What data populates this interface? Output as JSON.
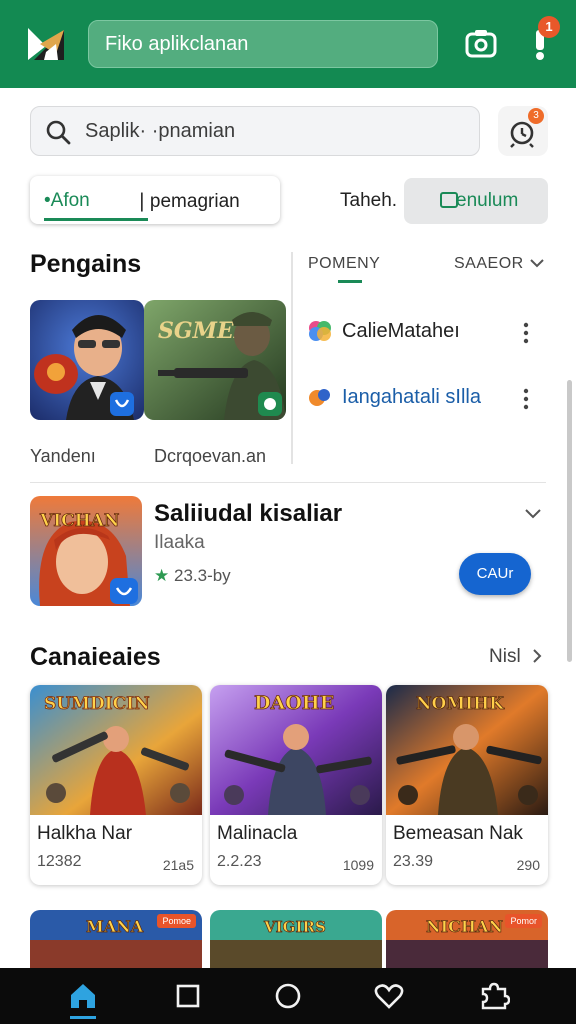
{
  "header": {
    "search_text": "Fiko aplikclanan",
    "notif_badge": "1"
  },
  "search": {
    "placeholder": "Saplik· ·pnamian",
    "notif_badge": "3"
  },
  "filters": {
    "chip1_part1": "•Afon",
    "chip1_part2": "❘pemagrian",
    "tab_label": "Taheh.",
    "chip2_label": "enulum"
  },
  "section1": {
    "title": "Pengains",
    "cards": [
      {
        "caption": "Yandenı",
        "art_text": ""
      },
      {
        "caption": "Dcrqoevan.an",
        "art_text": "SGMEN"
      }
    ],
    "right_tabs": [
      "POMENY",
      "SAAEOR"
    ],
    "list": [
      {
        "label": "CalieMataheı"
      },
      {
        "label": "Iangahatali sIlla"
      }
    ]
  },
  "featured": {
    "title": "Saliiudal kisaliar",
    "subtitle": "Ilaaka",
    "rating": "23.3-by",
    "art_text": "VICHAN",
    "button": "CAUr"
  },
  "section2": {
    "title": "Canaieaies",
    "more": "Nisl",
    "games": [
      {
        "name": "Halkha Nar",
        "value": "12382",
        "value2": "21a5",
        "art_text": "SUMDICIN"
      },
      {
        "name": "Malinacla",
        "value": "2.2.23",
        "value2": "1099",
        "art_text": "DAOHE"
      },
      {
        "name": "Bemeasan Nak",
        "value": "23.39",
        "value2": "290",
        "art_text": "NOMIHK"
      }
    ],
    "bottom_row": [
      {
        "art_text": "MANA",
        "badge": "Pomoe"
      },
      {
        "art_text": "VIGIRS",
        "badge": ""
      },
      {
        "art_text": "NICHAN",
        "badge": "Pomor"
      }
    ]
  },
  "colors": {
    "brand_green": "#138a52",
    "accent_blue": "#1565d0",
    "badge_red": "#e8582a"
  },
  "bottom_nav": [
    "home-icon",
    "square-icon",
    "circle-icon",
    "heart-icon",
    "puzzle-icon"
  ]
}
